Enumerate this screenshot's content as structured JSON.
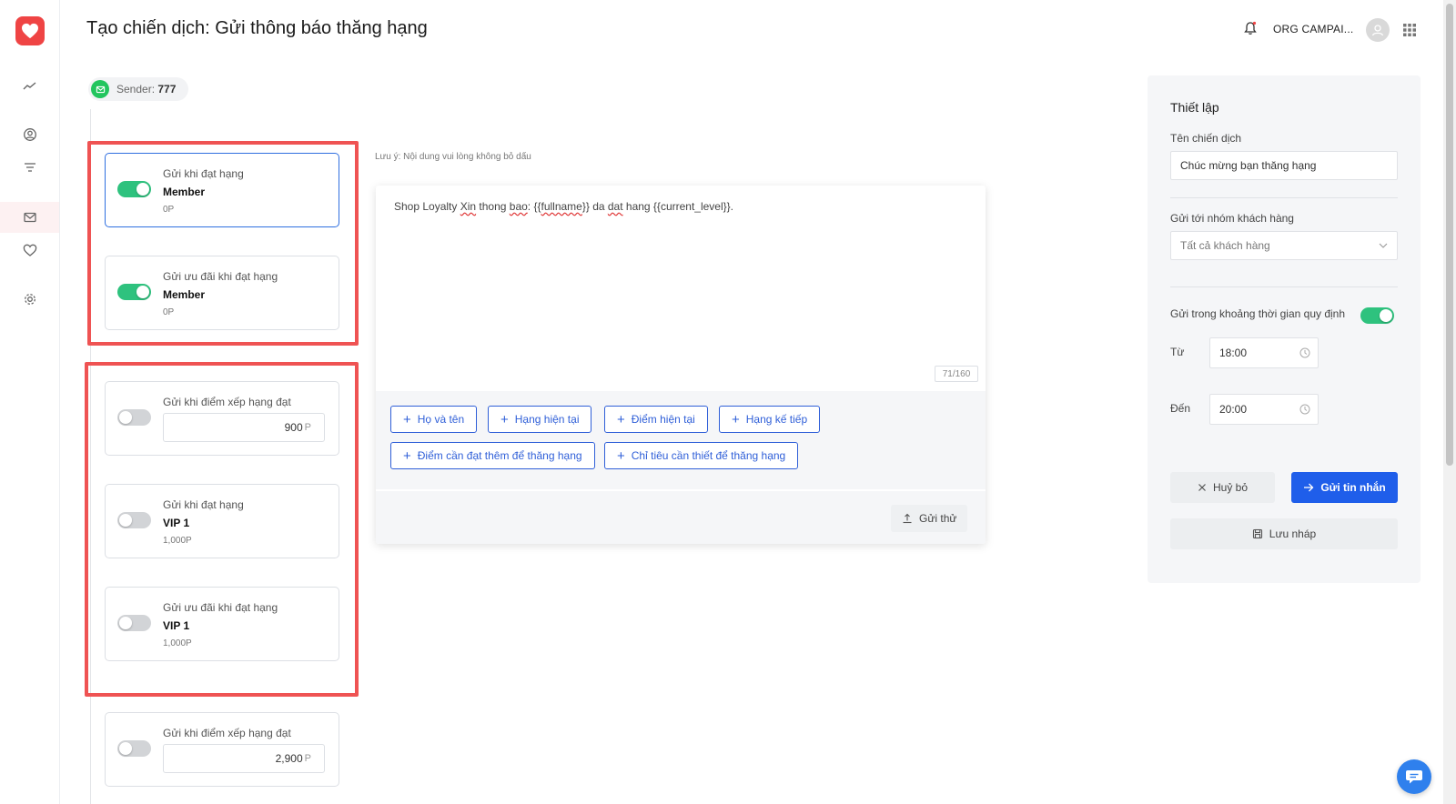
{
  "header": {
    "title": "Tạo chiến dịch: Gửi thông báo thăng hạng",
    "org_name": "ORG CAMPAI..."
  },
  "sender": {
    "label": "Sender:",
    "value": "777"
  },
  "triggers": [
    {
      "title": "Gửi khi đạt hạng",
      "level": "Member",
      "points": "0P",
      "enabled": true
    },
    {
      "title": "Gửi ưu đãi khi đạt hạng",
      "level": "Member",
      "points": "0P",
      "enabled": true
    },
    {
      "title": "Gửi khi điểm xếp hạng đạt",
      "value": "900",
      "currency": "P",
      "enabled": false
    },
    {
      "title": "Gửi khi đạt hạng",
      "level": "VIP 1",
      "points": "1,000P",
      "enabled": false
    },
    {
      "title": "Gửi ưu đãi khi đạt hạng",
      "level": "VIP 1",
      "points": "1,000P",
      "enabled": false
    },
    {
      "title": "Gửi khi điểm xếp hạng đạt",
      "value": "2,900",
      "currency": "P",
      "enabled": false
    }
  ],
  "editor": {
    "note": "Lưu ý: Nội dung vui lòng không bỏ dấu",
    "message_parts": [
      "Shop Loyalty ",
      "Xin",
      " thong ",
      "bao",
      ": {{",
      "fullname",
      "}} da ",
      "dat",
      " hang {{current_level}}."
    ],
    "counter": "71/160",
    "tags": [
      "Họ và tên",
      "Hạng hiện tại",
      "Điểm hiện tại",
      "Hạng kế tiếp",
      "Điểm cần đạt thêm để thăng hạng",
      "Chỉ tiêu cần thiết để thăng hạng"
    ],
    "test_button": "Gửi thử"
  },
  "settings": {
    "heading": "Thiết lập",
    "campaign_name_label": "Tên chiến dịch",
    "campaign_name_value": "Chúc mừng bạn thăng hạng",
    "group_label": "Gửi tới nhóm khách hàng",
    "group_value": "Tất cả khách hàng",
    "time_window_label": "Gửi trong khoảng thời gian quy định",
    "time_window_enabled": true,
    "from_label": "Từ",
    "from_value": "18:00",
    "to_label": "Đến",
    "to_value": "20:00",
    "cancel_label": "Huỷ bỏ",
    "send_label": "Gửi tin nhắn",
    "draft_label": "Lưu nháp"
  },
  "colors": {
    "brand": "#ef4444",
    "primary": "#1f5eea",
    "toggle_on": "#2ec27e",
    "highlight": "#ef5353"
  }
}
